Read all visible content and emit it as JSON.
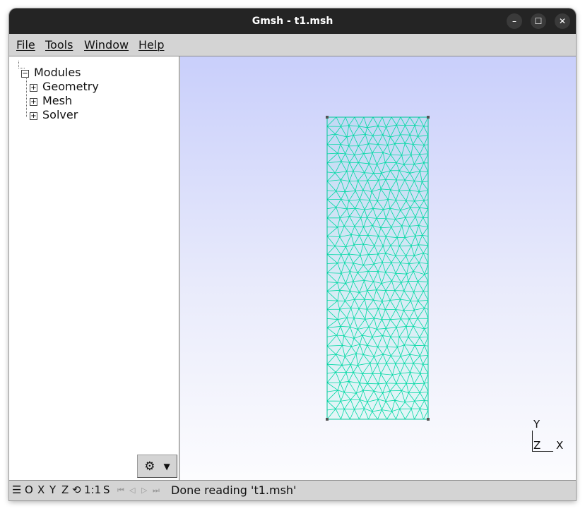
{
  "window": {
    "title": "Gmsh - t1.msh",
    "controls": {
      "minimize": "–",
      "maximize": "☐",
      "close": "✕"
    }
  },
  "menubar": {
    "items": [
      "File",
      "Tools",
      "Window",
      "Help"
    ]
  },
  "tree": {
    "root": {
      "label": "Modules",
      "toggle": "−"
    },
    "children": [
      {
        "label": "Geometry",
        "toggle": "+"
      },
      {
        "label": "Mesh",
        "toggle": "+"
      },
      {
        "label": "Solver",
        "toggle": "+"
      }
    ]
  },
  "gear_button": {
    "icon": "gear-icon",
    "glyph": "⚙",
    "arrow": "▼"
  },
  "statusbar": {
    "menu_glyph": "☰",
    "view_buttons": [
      "O",
      "X",
      "Y",
      "Z"
    ],
    "rotate_glyph": "⟲",
    "scale_label": "1:1",
    "select_label": "S",
    "playback": [
      "⏮",
      "◁",
      "▷",
      "⏭"
    ],
    "message": "Done reading 't1.msh'"
  },
  "axes": {
    "y": "Y",
    "z": "Z",
    "x": "X"
  },
  "colors": {
    "mesh_line": "#00d9a5",
    "mesh_fill": "#60f0d0",
    "viewport_top": "#c9cffb",
    "viewport_bottom": "#fcfcfe"
  }
}
